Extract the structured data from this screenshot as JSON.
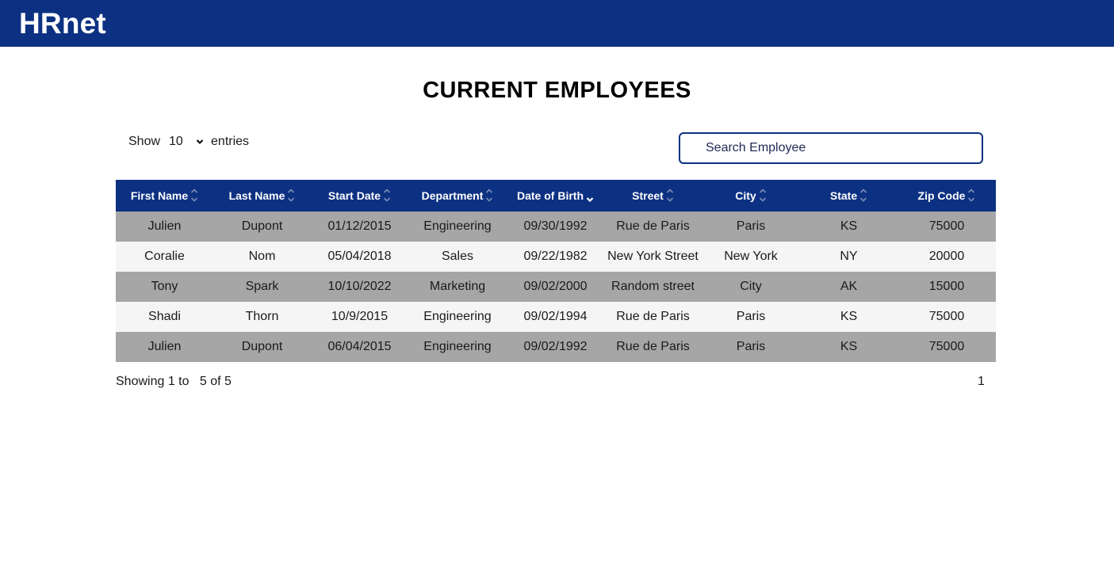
{
  "app": {
    "name": "HRnet"
  },
  "page": {
    "title": "CURRENT EMPLOYEES"
  },
  "controls": {
    "show_label": "Show",
    "entries_value": "10",
    "entries_label": "entries",
    "search_placeholder": "Search Employee"
  },
  "table": {
    "columns": [
      "First Name",
      "Last Name",
      "Start Date",
      "Department",
      "Date of Birth",
      "Street",
      "City",
      "State",
      "Zip Code"
    ],
    "active_sort_column": "Date of Birth",
    "rows": [
      [
        "Julien",
        "Dupont",
        "01/12/2015",
        "Engineering",
        "09/30/1992",
        "Rue de Paris",
        "Paris",
        "KS",
        "75000"
      ],
      [
        "Coralie",
        "Nom",
        "05/04/2018",
        "Sales",
        "09/22/1982",
        "New York Street",
        "New York",
        "NY",
        "20000"
      ],
      [
        "Tony",
        "Spark",
        "10/10/2022",
        "Marketing",
        "09/02/2000",
        "Random street",
        "City",
        "AK",
        "15000"
      ],
      [
        "Shadi",
        "Thorn",
        "10/9/2015",
        "Engineering",
        "09/02/1994",
        "Rue de Paris",
        "Paris",
        "KS",
        "75000"
      ],
      [
        "Julien",
        "Dupont",
        "06/04/2015",
        "Engineering",
        "09/02/1992",
        "Rue de Paris",
        "Paris",
        "KS",
        "75000"
      ]
    ]
  },
  "footer": {
    "showing_text": "Showing 1 to",
    "range_text": "5 of 5",
    "page_number": "1"
  },
  "colors": {
    "brand": "#0d3182",
    "row_odd": "#a6a6a6",
    "row_even": "#f5f5f5"
  }
}
